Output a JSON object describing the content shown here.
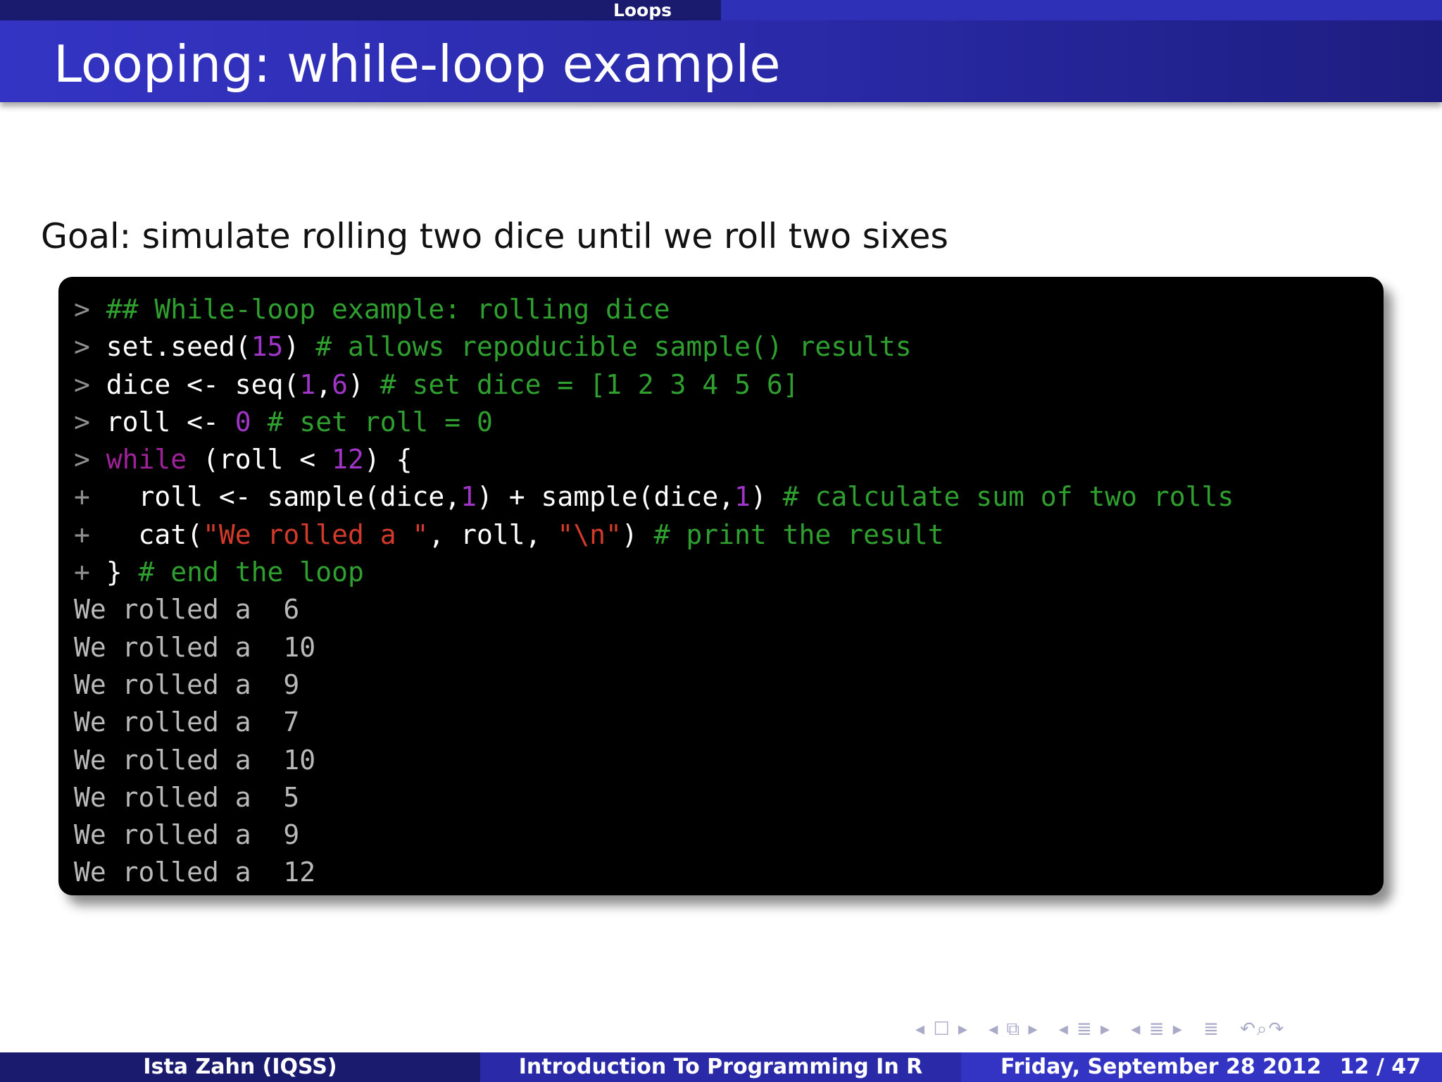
{
  "header": {
    "section": "Loops",
    "title": "Looping: while-loop example"
  },
  "body": {
    "goal": "Goal: simulate rolling two dice until we roll two sixes"
  },
  "code": {
    "input_lines": [
      "> ## While-loop example: rolling dice",
      "> set.seed(15) # allows repoducible sample() results",
      "> dice <- seq(1,6) # set dice = [1 2 3 4 5 6]",
      "> roll <- 0 # set roll = 0",
      "> while (roll < 12) {",
      "+   roll <- sample(dice,1) + sample(dice,1) # calculate sum of two rolls",
      "+   cat(\"We rolled a \", roll, \"\\n\") # print the result",
      "+ } # end the loop"
    ],
    "output_lines": [
      "We rolled a  6",
      "We rolled a  10",
      "We rolled a  9",
      "We rolled a  7",
      "We rolled a  10",
      "We rolled a  5",
      "We rolled a  9",
      "We rolled a  12"
    ]
  },
  "footer": {
    "author": "Ista Zahn  (IQSS)",
    "course": "Introduction To Programming In R",
    "date": "Friday, September 28 2012",
    "page": "12 / 47"
  },
  "colors": {
    "title_bar": "#2a2aa8",
    "code_background": "#000000",
    "comment": "#2fa02f",
    "number": "#a035c8",
    "keyword": "#a0229a",
    "string": "#d23a2a",
    "output": "#b9b9b9"
  },
  "nav_icons": [
    "frame-prev-icon",
    "frame-icon",
    "frame-next-icon",
    "subsection-prev-icon",
    "subsection-icon",
    "subsection-next-icon",
    "section-prev-icon",
    "section-icon",
    "section-next-icon",
    "toc-prev-icon",
    "toc-icon",
    "toc-next-icon",
    "align-icon",
    "undo-icon",
    "search-icon",
    "redo-icon"
  ]
}
